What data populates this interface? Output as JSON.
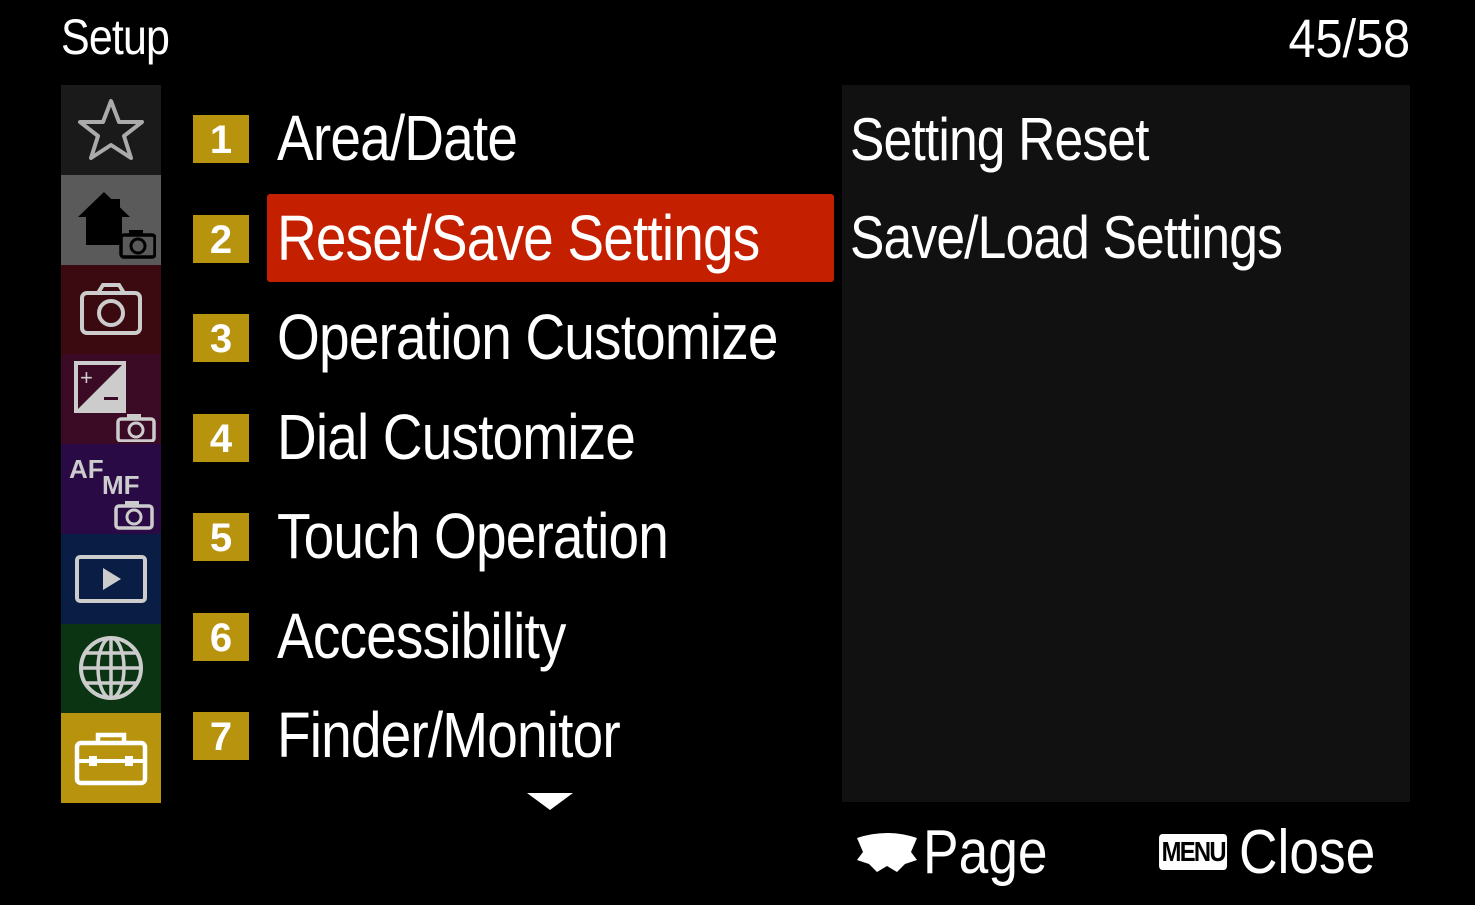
{
  "header": {
    "title": "Setup",
    "page_indicator": "45/58"
  },
  "tabs": [
    {
      "icon": "star-icon",
      "bg": "#1a1a1a"
    },
    {
      "icon": "home-camera-icon",
      "bg": "#5a5a5a"
    },
    {
      "icon": "camera-icon",
      "bg": "#3a0a10"
    },
    {
      "icon": "exposure-camera-icon",
      "bg": "#3b0a25"
    },
    {
      "icon": "af-mf-camera-icon",
      "bg": "#2a0a45",
      "text_af": "AF",
      "text_mf": "MF"
    },
    {
      "icon": "playback-icon",
      "bg": "#0a1e45"
    },
    {
      "icon": "globe-icon",
      "bg": "#0b3413"
    },
    {
      "icon": "toolbox-icon",
      "bg": "#b8930d"
    }
  ],
  "menu": {
    "items": [
      {
        "num": "1",
        "label": "Area/Date"
      },
      {
        "num": "2",
        "label": "Reset/Save Settings",
        "selected": true
      },
      {
        "num": "3",
        "label": "Operation Customize"
      },
      {
        "num": "4",
        "label": "Dial Customize"
      },
      {
        "num": "5",
        "label": "Touch Operation"
      },
      {
        "num": "6",
        "label": "Accessibility"
      },
      {
        "num": "7",
        "label": "Finder/Monitor"
      }
    ]
  },
  "submenu": {
    "items": [
      "Setting Reset",
      "Save/Load Settings"
    ]
  },
  "footer": {
    "page_label": "Page",
    "menu_key": "MENU",
    "close_label": "Close"
  },
  "colors": {
    "accent": "#c42000",
    "number_badge": "#b8930d",
    "setup_tab": "#b8930d"
  }
}
